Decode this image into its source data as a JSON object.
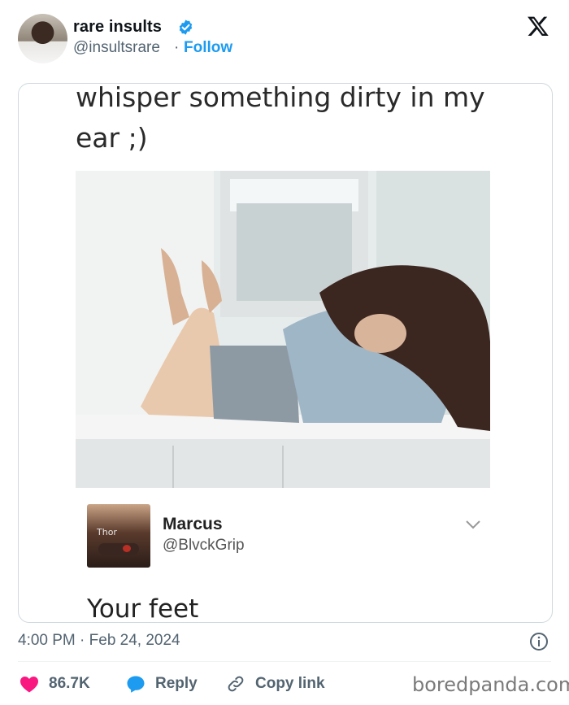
{
  "author": {
    "display_name": "rare insults",
    "handle": "@insultsrare",
    "separator": "·",
    "follow_label": "Follow"
  },
  "tweet": {
    "text_line1": "whisper something dirty in my",
    "text_line2": "ear ;)",
    "reply": {
      "name": "Marcus",
      "handle": "@BlvckGrip",
      "avatar_overlay_text": "Thor",
      "text": "Your feet"
    }
  },
  "meta": {
    "timestamp": "4:00 PM · Feb 24, 2024"
  },
  "actions": {
    "like_count": "86.7K",
    "reply_label": "Reply",
    "copy_label": "Copy link"
  },
  "watermark": "boredpanda.com",
  "colors": {
    "accent": "#1d9bf0",
    "like": "#f91880",
    "text": "#0f1419",
    "muted": "#536471"
  },
  "icons": [
    "verified-badge-icon",
    "x-logo-icon",
    "chevron-down-icon",
    "info-icon",
    "heart-icon",
    "reply-bubble-icon",
    "link-icon"
  ]
}
